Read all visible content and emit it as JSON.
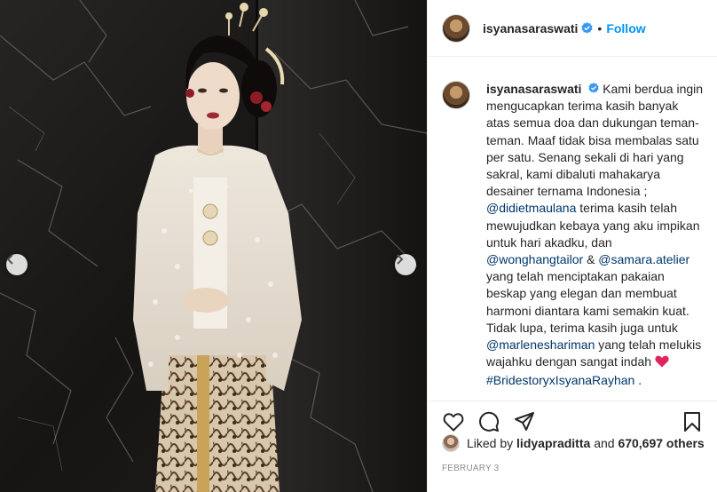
{
  "post": {
    "username": "isyanasaraswati",
    "follow_label": "Follow",
    "separator": "•",
    "caption": {
      "username": "isyanasaraswati",
      "text_1": "Kami berdua ingin mengucapkan terima kasih banyak atas semua doa dan dukungan teman-teman. Maaf tidak bisa membalas satu per satu. Senang sekali di hari yang sakral, kami dibaluti mahakarya desainer ternama Indonesia ;",
      "mention_1": "@didietmaulana",
      "text_2": "terima kasih telah mewujudkan kebaya yang aku impikan untuk hari akadku, dan",
      "mention_2": "@wonghangtailor",
      "text_3": "&",
      "mention_3": "@samara.atelier",
      "text_4": "yang telah menciptakan pakaian beskap yang elegan dan membuat harmoni diantara kami semakin kuat. Tidak lupa, terima kasih juga untuk",
      "mention_4": "@marleneshariman",
      "text_5": "yang telah melukis wajahku dengan sangat indah",
      "hashtag": "#BridestoryxIsyanaRayhan",
      "text_6": ".",
      "text_7": "."
    },
    "likes": {
      "prefix": "Liked by",
      "user": "lidyapraditta",
      "conjunction": "and",
      "count": "670,697 others"
    },
    "date": "FEBRUARY 3"
  },
  "icons": {
    "verified": "verified-badge-icon",
    "like": "heart-outline-icon",
    "comment": "comment-icon",
    "share": "share-icon",
    "save": "bookmark-icon",
    "prev": "chevron-left-icon",
    "next": "chevron-right-icon"
  },
  "colors": {
    "follow": "#0095f6",
    "mention": "#00376b",
    "verified": "#3897f0",
    "heart_emoji": "#e0245e",
    "meta": "#8e8e8e"
  }
}
